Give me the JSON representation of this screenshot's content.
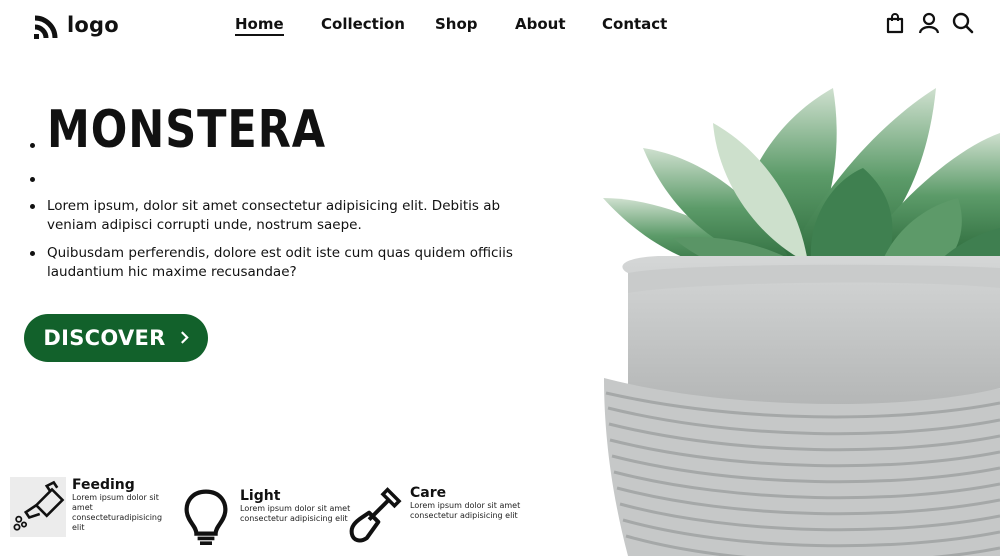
{
  "header": {
    "logo_text": "logo",
    "nav": [
      "Home",
      "Collection",
      "Shop",
      "About",
      "Contact"
    ],
    "active_nav": "Home",
    "icons": [
      "shopping-bag-icon",
      "user-icon",
      "search-icon"
    ]
  },
  "hero": {
    "title": "MONSTERA",
    "paragraphs": [
      "Lorem ipsum, dolor sit amet consectetur adipisicing elit. Debitis ab veniam adipisci corrupti unde, nostrum saepe.",
      "Quibusdam perferendis, dolore est odit iste cum quas quidem officiis laudantium hic maxime recusandae?"
    ],
    "button_label": "DISCOVER",
    "button_icon": "chevron-right-icon",
    "image": "potted-succulent-image"
  },
  "features": [
    {
      "title": "Feeding",
      "desc": "Lorem ipsum dolor sit amet consecteturadipisicing elit",
      "icon": "watering-can-icon"
    },
    {
      "title": "Light",
      "desc": "Lorem ipsum dolor sit amet consectetur adipisicing elit",
      "icon": "lightbulb-icon"
    },
    {
      "title": "Care",
      "desc": "Lorem ipsum dolor sit amet consectetur adipisicing elit",
      "icon": "shovel-icon"
    }
  ],
  "colors": {
    "accent": "#12612b",
    "text": "#111111",
    "background": "#ffffff"
  }
}
